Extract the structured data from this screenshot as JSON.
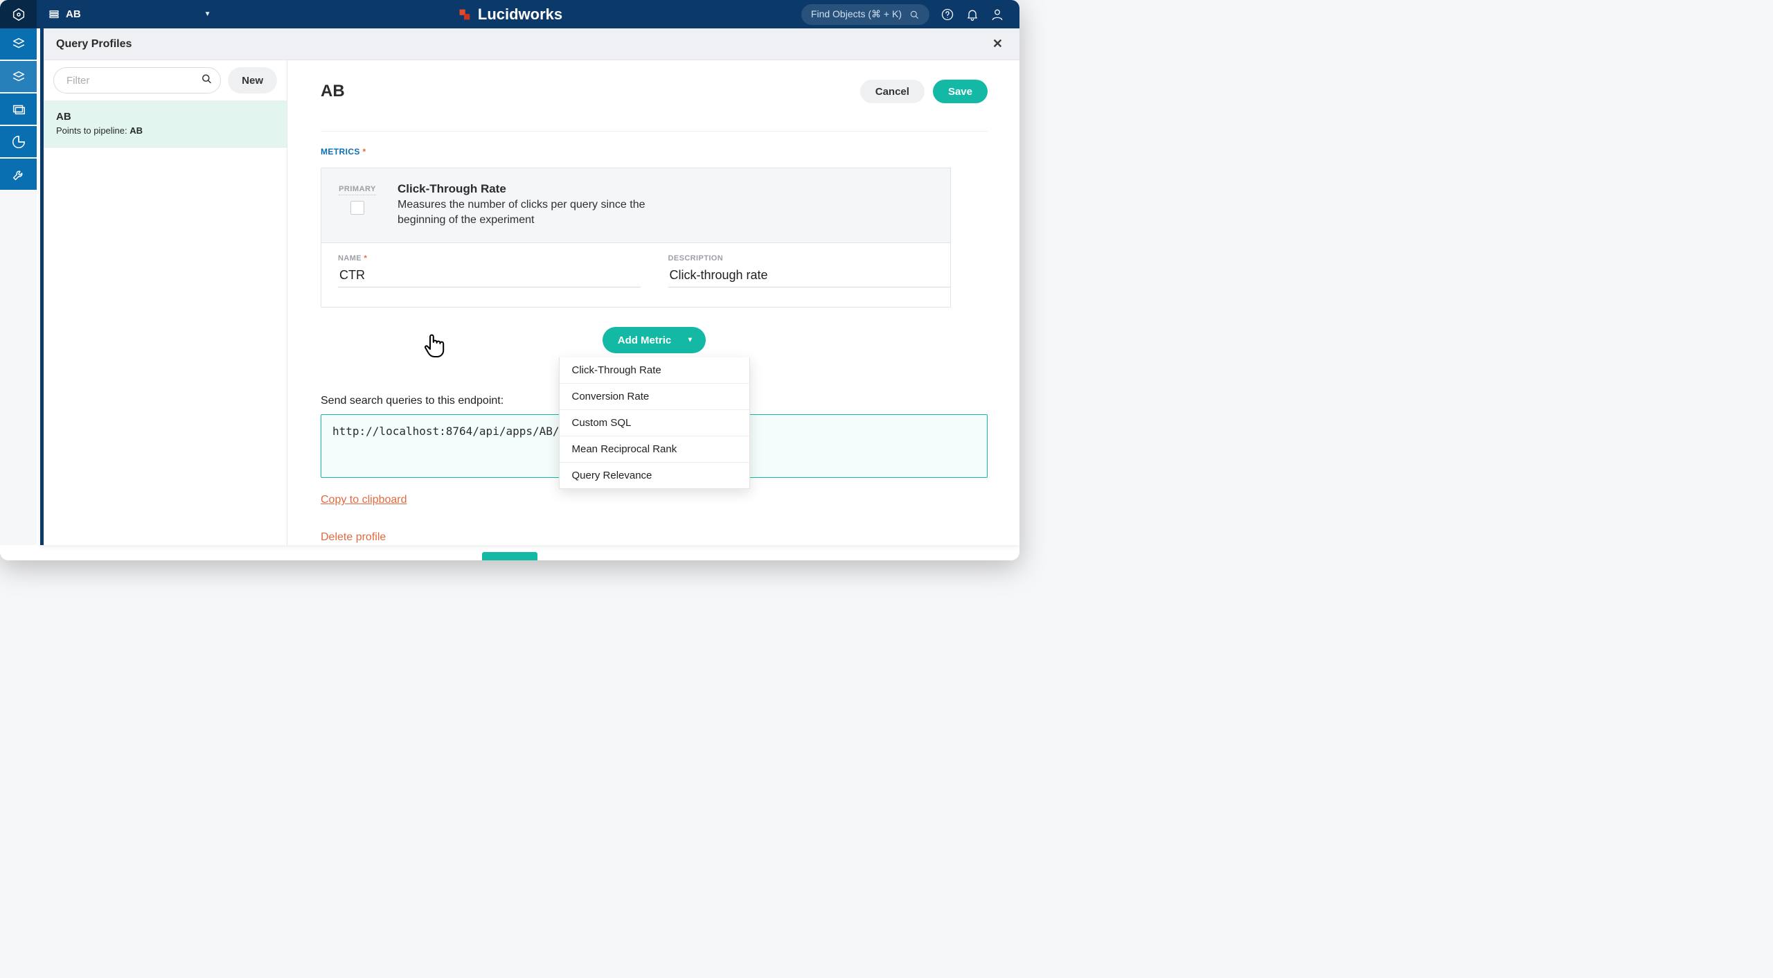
{
  "header": {
    "app_name": "AB",
    "brand": "Lucidworks",
    "find_placeholder": "Find Objects (⌘ + K)"
  },
  "panel": {
    "title": "Query Profiles"
  },
  "list": {
    "filter_placeholder": "Filter",
    "new_label": "New",
    "items": [
      {
        "name": "AB",
        "sub_prefix": "Points to pipeline: ",
        "pipeline": "AB"
      }
    ]
  },
  "detail": {
    "title": "AB",
    "cancel": "Cancel",
    "save": "Save",
    "metrics_label": "METRICS",
    "primary_label": "PRIMARY",
    "metric_title": "Click-Through Rate",
    "metric_sub": "Measures the number of clicks per query since the beginning of the experiment",
    "name_label": "NAME",
    "desc_label": "DESCRIPTION",
    "name_value": "CTR",
    "desc_value": "Click-through rate",
    "add_metric": "Add Metric",
    "dropdown": [
      "Click-Through Rate",
      "Conversion Rate",
      "Custom SQL",
      "Mean Reciprocal Rank",
      "Query Relevance"
    ],
    "endpoint_label": "Send search queries to this endpoint:",
    "endpoint_value": "http://localhost:8764/api/apps/AB/query/A",
    "copy": "Copy to clipboard",
    "delete": "Delete profile"
  }
}
